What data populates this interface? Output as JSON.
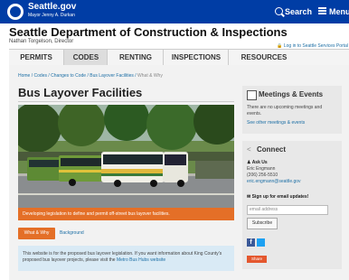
{
  "header": {
    "brand": "Seattle.gov",
    "brand_sub": "Mayor Jenny A. Durkan",
    "search_label": "Search",
    "menu_label": "Menu"
  },
  "department": {
    "title": "Seattle Department of Construction & Inspections",
    "director": "Nathan Torgelson, Director",
    "login_link": "Log in to Seattle Services Portal"
  },
  "nav": {
    "items": [
      "PERMITS",
      "CODES",
      "RENTING",
      "INSPECTIONS",
      "RESOURCES"
    ],
    "active": "CODES"
  },
  "breadcrumb": {
    "items": [
      "Home",
      "Codes",
      "Changes to Code",
      "Bus Layover Facilities",
      "What & Why"
    ],
    "separator": " / "
  },
  "page": {
    "title": "Bus Layover Facilities",
    "hero_caption": "Developing legislation to define and permit off-street bus layover facilities.",
    "tabs": [
      "What & Why",
      "Background"
    ],
    "info_text": "This website is for the proposed bus layover legislation. If you want information about King County's proposed bus layover projects, please visit the",
    "info_link": "Metro Bus Hubs website"
  },
  "sidebar": {
    "meetings": {
      "title": "Meetings & Events",
      "text_line1": "There are no upcoming meetings and",
      "text_line2": "events.",
      "link": "See other meetings & events"
    },
    "connect": {
      "title": "Connect",
      "ask_us": "Ask Us",
      "contact_name": "Eric Engmann",
      "contact_phone": "(206) 256-5510",
      "contact_email": "eric.engmann@seattle.gov",
      "signup": "Sign up for email updates!",
      "email_placeholder": "email address",
      "subscribe": "Subscribe",
      "share": "Share"
    }
  },
  "colors": {
    "brand_blue": "#003da5",
    "accent_orange": "#e46f27",
    "link_blue": "#1d6fa5"
  }
}
